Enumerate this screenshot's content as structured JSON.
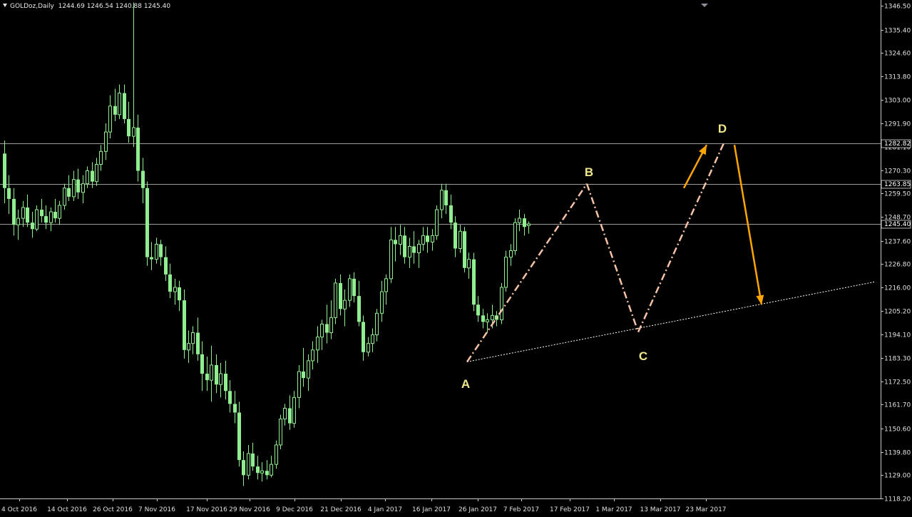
{
  "header": {
    "symbol_timeframe": "GOLDoz,Daily",
    "ohlc": "1244.69 1246.54 1240.88 1245.40"
  },
  "colors": {
    "background": "#000000",
    "bull_candle": "#90ee90",
    "bear_candle": "#90ee90",
    "grid_and_axes": "#c8c8c8",
    "pattern_line": "#f4c2a6",
    "arrows": "#ffa500",
    "point_labels": "#f0e68c"
  },
  "chart_data": {
    "type": "candlestick",
    "symbol": "GOLDoz",
    "timeframe": "Daily",
    "price_axis_ticks": [
      "1346.50",
      "1335.40",
      "1324.60",
      "1313.80",
      "1303.00",
      "1291.90",
      "1281.10",
      "1270.30",
      "1259.50",
      "1248.70",
      "1237.60",
      "1226.80",
      "1216.00",
      "1205.20",
      "1194.10",
      "1183.30",
      "1172.50",
      "1161.70",
      "1150.60",
      "1139.80",
      "1129.00",
      "1118.20"
    ],
    "time_axis_ticks": [
      "4 Oct 2016",
      "14 Oct 2016",
      "26 Oct 2016",
      "7 Nov 2016",
      "17 Nov 2016",
      "29 Nov 2016",
      "9 Dec 2016",
      "21 Dec 2016",
      "4 Jan 2017",
      "16 Jan 2017",
      "26 Jan 2017",
      "7 Feb 2017",
      "17 Feb 2017",
      "1 Mar 2017",
      "13 Mar 2017",
      "23 Mar 2017"
    ],
    "horizontal_levels": [
      {
        "price": 1282.82,
        "label": "1282.82"
      },
      {
        "price": 1263.85,
        "label": "1263.85"
      },
      {
        "price": 1245.4,
        "label": "1245.40"
      }
    ],
    "last_price": 1245.4,
    "ohlc": [
      [
        1278,
        1284,
        1255,
        1262
      ],
      [
        1262,
        1268,
        1250,
        1257
      ],
      [
        1257,
        1262,
        1240,
        1245
      ],
      [
        1245,
        1252,
        1238,
        1248
      ],
      [
        1248,
        1256,
        1244,
        1253
      ],
      [
        1253,
        1259,
        1244,
        1246
      ],
      [
        1246,
        1251,
        1239,
        1243
      ],
      [
        1243,
        1254,
        1242,
        1252
      ],
      [
        1252,
        1257,
        1246,
        1249
      ],
      [
        1249,
        1254,
        1243,
        1246
      ],
      [
        1246,
        1253,
        1242,
        1251
      ],
      [
        1251,
        1257,
        1246,
        1248
      ],
      [
        1248,
        1256,
        1245,
        1254
      ],
      [
        1254,
        1264,
        1252,
        1262
      ],
      [
        1262,
        1268,
        1256,
        1258
      ],
      [
        1258,
        1270,
        1256,
        1266
      ],
      [
        1266,
        1271,
        1257,
        1260
      ],
      [
        1260,
        1268,
        1255,
        1264
      ],
      [
        1264,
        1272,
        1262,
        1270
      ],
      [
        1270,
        1274,
        1262,
        1265
      ],
      [
        1265,
        1276,
        1263,
        1273
      ],
      [
        1273,
        1282,
        1270,
        1279
      ],
      [
        1279,
        1292,
        1275,
        1288
      ],
      [
        1288,
        1305,
        1285,
        1300
      ],
      [
        1300,
        1308,
        1293,
        1296
      ],
      [
        1296,
        1310,
        1294,
        1306
      ],
      [
        1306,
        1310,
        1292,
        1294
      ],
      [
        1294,
        1302,
        1283,
        1286
      ],
      [
        1286,
        1348,
        1281,
        1290
      ],
      [
        1290,
        1296,
        1265,
        1270
      ],
      [
        1270,
        1276,
        1255,
        1262
      ],
      [
        1262,
        1265,
        1226,
        1230
      ],
      [
        1230,
        1237,
        1224,
        1229
      ],
      [
        1229,
        1239,
        1227,
        1236
      ],
      [
        1236,
        1238,
        1226,
        1230
      ],
      [
        1230,
        1235,
        1219,
        1222
      ],
      [
        1222,
        1227,
        1211,
        1214
      ],
      [
        1214,
        1220,
        1208,
        1216
      ],
      [
        1216,
        1219,
        1205,
        1210
      ],
      [
        1210,
        1215,
        1183,
        1187
      ],
      [
        1187,
        1196,
        1181,
        1190
      ],
      [
        1190,
        1198,
        1185,
        1195
      ],
      [
        1195,
        1202,
        1182,
        1185
      ],
      [
        1185,
        1191,
        1168,
        1176
      ],
      [
        1176,
        1184,
        1168,
        1173
      ],
      [
        1173,
        1189,
        1163,
        1180
      ],
      [
        1180,
        1185,
        1167,
        1171
      ],
      [
        1171,
        1181,
        1165,
        1176
      ],
      [
        1176,
        1182,
        1164,
        1168
      ],
      [
        1168,
        1173,
        1158,
        1162
      ],
      [
        1162,
        1168,
        1153,
        1158
      ],
      [
        1158,
        1163,
        1133,
        1136
      ],
      [
        1136,
        1140,
        1124,
        1129
      ],
      [
        1129,
        1143,
        1127,
        1139
      ],
      [
        1139,
        1144,
        1131,
        1133
      ],
      [
        1133,
        1138,
        1127,
        1130
      ],
      [
        1130,
        1135,
        1126,
        1131
      ],
      [
        1131,
        1136,
        1127,
        1129
      ],
      [
        1129,
        1138,
        1128,
        1134
      ],
      [
        1134,
        1145,
        1132,
        1143
      ],
      [
        1143,
        1157,
        1141,
        1155
      ],
      [
        1155,
        1162,
        1152,
        1160
      ],
      [
        1160,
        1166,
        1150,
        1153
      ],
      [
        1153,
        1168,
        1151,
        1165
      ],
      [
        1165,
        1180,
        1160,
        1177
      ],
      [
        1177,
        1188,
        1170,
        1174
      ],
      [
        1174,
        1185,
        1168,
        1182
      ],
      [
        1182,
        1191,
        1178,
        1187
      ],
      [
        1187,
        1198,
        1181,
        1193
      ],
      [
        1193,
        1201,
        1187,
        1199
      ],
      [
        1199,
        1208,
        1190,
        1195
      ],
      [
        1195,
        1210,
        1192,
        1202
      ],
      [
        1202,
        1220,
        1199,
        1218
      ],
      [
        1218,
        1222,
        1203,
        1206
      ],
      [
        1206,
        1215,
        1198,
        1210
      ],
      [
        1210,
        1222,
        1207,
        1220
      ],
      [
        1220,
        1223,
        1209,
        1212
      ],
      [
        1212,
        1219,
        1198,
        1200
      ],
      [
        1200,
        1203,
        1182,
        1186
      ],
      [
        1186,
        1193,
        1184,
        1190
      ],
      [
        1190,
        1197,
        1186,
        1194
      ],
      [
        1194,
        1206,
        1191,
        1204
      ],
      [
        1204,
        1219,
        1200,
        1214
      ],
      [
        1214,
        1222,
        1208,
        1220
      ],
      [
        1220,
        1244,
        1218,
        1238
      ],
      [
        1238,
        1244,
        1228,
        1236
      ],
      [
        1236,
        1245,
        1231,
        1240
      ],
      [
        1240,
        1244,
        1227,
        1230
      ],
      [
        1230,
        1239,
        1225,
        1235
      ],
      [
        1235,
        1242,
        1227,
        1232
      ],
      [
        1232,
        1238,
        1225,
        1236
      ],
      [
        1236,
        1244,
        1233,
        1240
      ],
      [
        1240,
        1244,
        1232,
        1237
      ],
      [
        1237,
        1243,
        1233,
        1240
      ],
      [
        1240,
        1254,
        1238,
        1252
      ],
      [
        1252,
        1264,
        1248,
        1261
      ],
      [
        1261,
        1264,
        1250,
        1254
      ],
      [
        1254,
        1259,
        1243,
        1246
      ],
      [
        1246,
        1249,
        1230,
        1234
      ],
      [
        1234,
        1245,
        1232,
        1242
      ],
      [
        1242,
        1244,
        1223,
        1225
      ],
      [
        1225,
        1232,
        1220,
        1229
      ],
      [
        1229,
        1232,
        1205,
        1208
      ],
      [
        1208,
        1212,
        1200,
        1203
      ],
      [
        1203,
        1206,
        1197,
        1200
      ],
      [
        1200,
        1204,
        1195,
        1201
      ],
      [
        1201,
        1208,
        1197,
        1203
      ],
      [
        1203,
        1205,
        1198,
        1201
      ],
      [
        1201,
        1218,
        1199,
        1216
      ],
      [
        1216,
        1233,
        1214,
        1230
      ],
      [
        1230,
        1236,
        1226,
        1233
      ],
      [
        1233,
        1248,
        1231,
        1246
      ],
      [
        1246,
        1252,
        1242,
        1248
      ],
      [
        1248,
        1250,
        1240,
        1244
      ],
      [
        1244.69,
        1246.54,
        1240.88,
        1245.4
      ]
    ],
    "pattern": {
      "name": "ABCD",
      "points": [
        {
          "label": "A",
          "price": 1181.5
        },
        {
          "label": "B",
          "price": 1264.0
        },
        {
          "label": "C",
          "price": 1195.3
        },
        {
          "label": "D",
          "price": 1282.8
        }
      ]
    },
    "trendline": {
      "from_price": 1181.5,
      "to_price": 1218.5
    },
    "arrows": [
      {
        "direction": "up",
        "from_price": 1262,
        "to_price": 1282
      },
      {
        "direction": "down",
        "from_price": 1282,
        "to_price": 1208
      }
    ]
  }
}
